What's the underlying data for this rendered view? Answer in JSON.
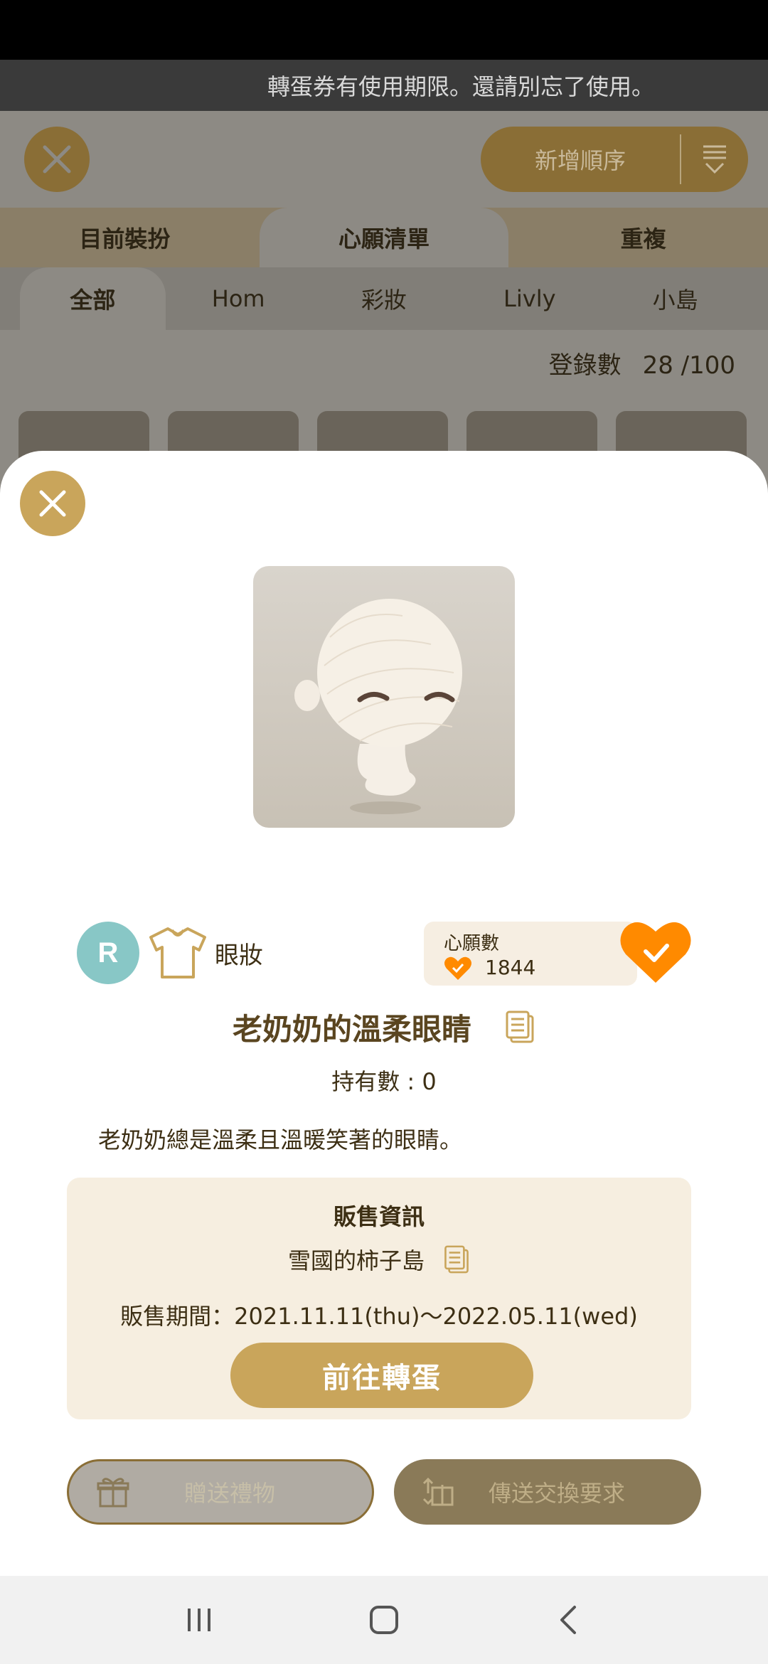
{
  "notice": "轉蛋券有使用期限。還請別忘了使用。",
  "background": {
    "order_button_label": "新增順序",
    "tabs": [
      "目前裝扮",
      "心願清單",
      "重複"
    ],
    "subtabs": [
      "全部",
      "Hom",
      "彩妝",
      "Livly",
      "小島"
    ],
    "count_label": "登錄數",
    "count_value": "28 /100"
  },
  "item": {
    "rarity": "R",
    "category": "眼妝",
    "wish_label": "心願數",
    "wish_count": "1844",
    "name": "老奶奶的溫柔眼睛",
    "owned": "持有數 : 0",
    "description": "老奶奶總是溫柔且溫暖笑著的眼睛。"
  },
  "sale": {
    "title": "販售資訊",
    "island": "雪國的柿子島",
    "period": "販售期間：2021.11.11(thu)～2022.05.11(wed)",
    "button": "前往轉蛋"
  },
  "actions": {
    "gift": "贈送禮物",
    "trade": "傳送交換要求"
  },
  "colors": {
    "accent": "#c9a55b",
    "rarity": "#88c7c6",
    "wish_heart": "#ff8a00",
    "sale_bg": "#f6eee0"
  }
}
